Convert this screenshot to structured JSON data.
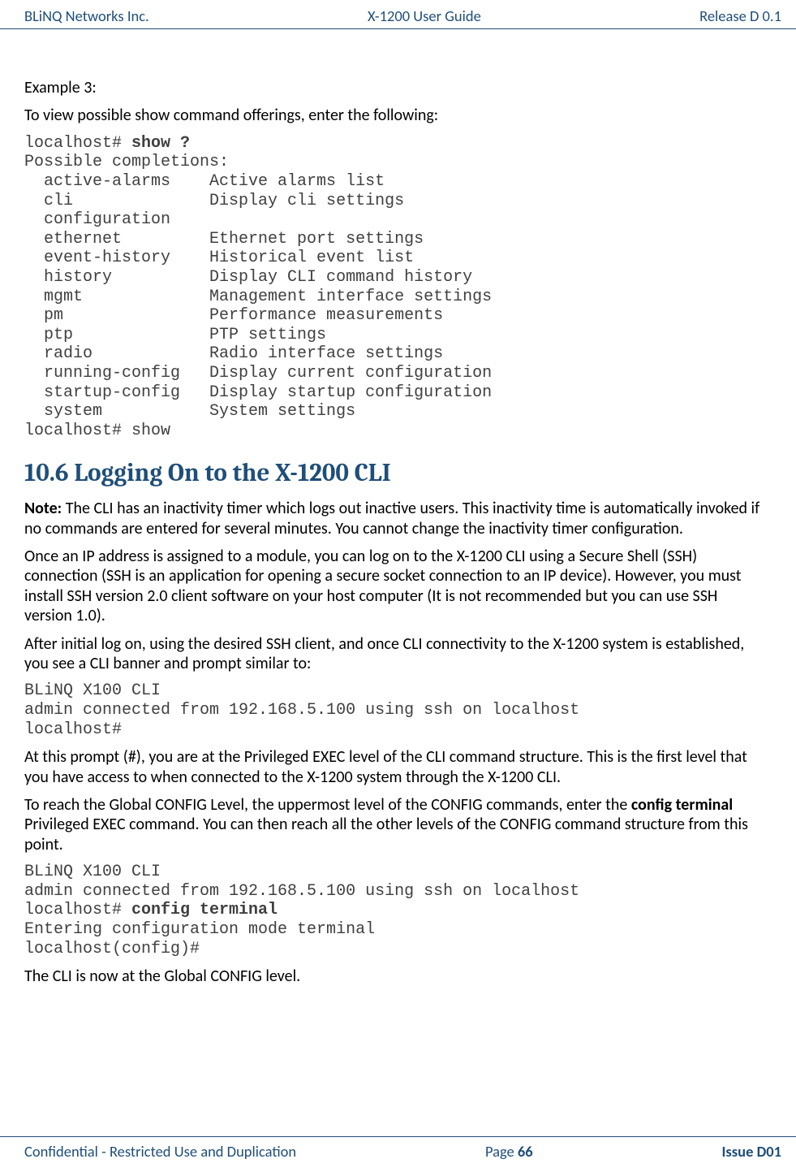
{
  "header": {
    "left": "BLiNQ Networks Inc.",
    "center": "X-1200 User Guide",
    "right": "Release D 0.1"
  },
  "example_label": "Example 3:",
  "p1": "To view possible show command offerings, enter the following:",
  "code1": {
    "l1a": "local​host# ",
    "l1b": "show ?",
    "l2": "Possible completions:",
    "l3": "  active-alarms    Active alarms list",
    "l4": "  cli              Display cli settings",
    "l5": "  configuration",
    "l6": "  ethernet         Ethernet port settings",
    "l7": "  event-history    Historical event list",
    "l8": "  history          Display CLI command history",
    "l9": "  mgmt             Management interface settings",
    "l10": "  pm               Performance measurements",
    "l11": "  ptp              PTP settings",
    "l12": "  radio            Radio interface settings",
    "l13": "  running-config   Display current configuration",
    "l14": "  startup-config   Display startup configuration",
    "l15": "  system           System settings",
    "l16": "local​host# show"
  },
  "section_heading": "10.6 Logging On to the X-1200 CLI",
  "note_label": "Note:",
  "note_body": " The CLI has an inactivity timer which logs out inactive users. This inactivity time is automatically invoked if no commands are entered for several minutes. You cannot change the inactivity timer configuration.",
  "p2": "Once an IP address is assigned to a module, you can log on to the X-1200 CLI using a Secure Shell (SSH) connection (SSH is an application for opening a secure socket connection to an IP device).  However, you must install SSH version 2.0 client software on your host computer (It is not recommended but you can use SSH version 1.0).",
  "p3": "After initial log on, using the desired SSH client, and once CLI connectivity to the X-1200 system is established, you see a CLI banner and prompt similar to:",
  "code2": {
    "l1": "BLiNQ X100 CLI",
    "l2": "admin connected from 192.168.5.100 using ssh on localhost",
    "l3": "local​host#"
  },
  "p4": "At this prompt (#), you are at the Privileged EXEC level of the CLI command structure. This is the first level that you have access to when connected to the X-1200 system through the X-1200 CLI.",
  "p5a": "To reach the Global CONFIG Level, the uppermost level of the CONFIG commands, enter the ",
  "p5b": "config terminal",
  "p5c": " Privileged EXEC command. You can then reach all the other levels of the CONFIG command structure from this point.",
  "code3": {
    "l1": "BLiNQ X100 CLI",
    "l2": "admin connected from 192.168.5.100 using ssh on localhost",
    "l3a": "local​host# ",
    "l3b": "config terminal",
    "l4": "Entering configuration mode terminal",
    "l5": "local​host(config)#"
  },
  "p6": "The CLI is now at the Global CONFIG level.",
  "footer": {
    "left": "Confidential - Restricted Use and Duplication",
    "center_a": "Page ",
    "center_b": "66",
    "right": "Issue D01"
  }
}
